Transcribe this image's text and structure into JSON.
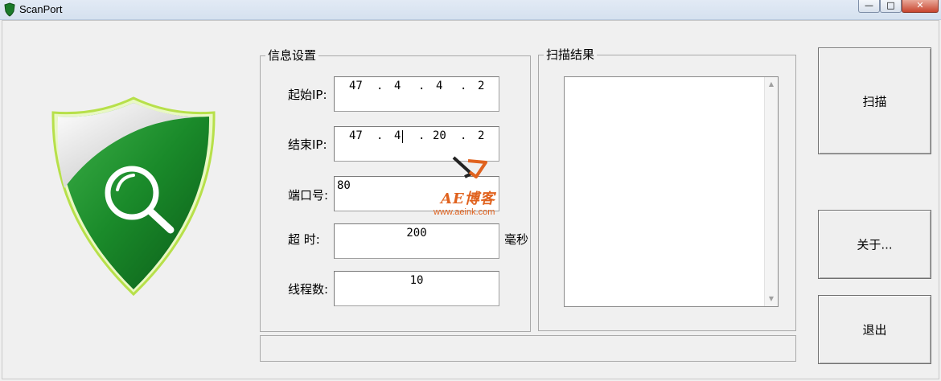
{
  "window": {
    "title": "ScanPort",
    "minimize_glyph": "—",
    "maximize_glyph": "□",
    "close_glyph": "✕"
  },
  "info_group": {
    "title": "信息设置",
    "start_ip_label": "起始IP:",
    "start_ip": [
      "47",
      "4",
      "4",
      "2"
    ],
    "end_ip_label": "结束IP:",
    "end_ip": [
      "47",
      "4",
      "20",
      "2"
    ],
    "ip_dot": ".",
    "port_label": "端口号:",
    "port_value": "80",
    "timeout_label": "超  时:",
    "timeout_value": "200",
    "timeout_unit": "毫秒",
    "threads_label": "线程数:",
    "threads_value": "10"
  },
  "result_group": {
    "title": "扫描结果"
  },
  "buttons": {
    "scan": "扫描",
    "about": "关于...",
    "exit": "退出"
  },
  "watermark": {
    "logo_text": "AE博客",
    "url": "www.aeink.com"
  },
  "colors": {
    "shield_green": "#1a8a2a",
    "shield_rim": "#b7e04a",
    "watermark_orange": "#e0621e"
  }
}
